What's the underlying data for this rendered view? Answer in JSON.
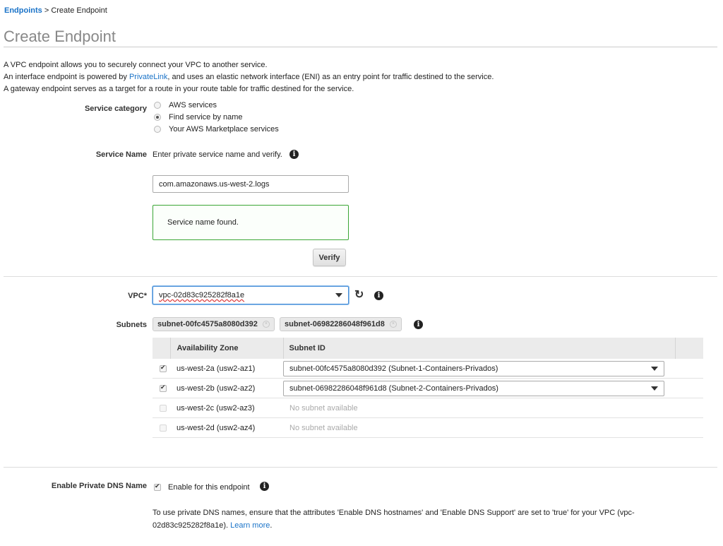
{
  "breadcrumb": {
    "parent": "Endpoints",
    "separator": " > ",
    "current": "Create Endpoint"
  },
  "page_title": "Create Endpoint",
  "intro": {
    "line1": "A VPC endpoint allows you to securely connect your VPC to another service.",
    "line2_before": "An interface endpoint is powered by ",
    "line2_link": "PrivateLink",
    "line2_after": ", and uses an elastic network interface (ENI) as an entry point for traffic destined to the service.",
    "line3": "A gateway endpoint serves as a target for a route in your route table for traffic destined for the service."
  },
  "service_category": {
    "label": "Service category",
    "options": [
      "AWS services",
      "Find service by name",
      "Your AWS Marketplace services"
    ],
    "selected": "Find service by name"
  },
  "service_name": {
    "label": "Service Name",
    "hint": "Enter private service name and verify.",
    "value": "com.amazonaws.us-west-2.logs",
    "status": "Service name found.",
    "verify_label": "Verify"
  },
  "vpc": {
    "label": "VPC*",
    "value": "vpc-02d83c925282f8a1e"
  },
  "subnets": {
    "label": "Subnets",
    "tags": [
      "subnet-00fc4575a8080d392",
      "subnet-06982286048f961d8"
    ],
    "columns": [
      "Availability Zone",
      "Subnet ID"
    ],
    "rows": [
      {
        "checked": true,
        "az": "us-west-2a (usw2-az1)",
        "subnet": "subnet-00fc4575a8080d392 (Subnet-1-Containers-Privados)",
        "available": true
      },
      {
        "checked": true,
        "az": "us-west-2b (usw2-az2)",
        "subnet": "subnet-06982286048f961d8 (Subnet-2-Containers-Privados)",
        "available": true
      },
      {
        "checked": false,
        "az": "us-west-2c (usw2-az3)",
        "subnet": "No subnet available",
        "available": false
      },
      {
        "checked": false,
        "az": "us-west-2d (usw2-az4)",
        "subnet": "No subnet available",
        "available": false
      }
    ]
  },
  "private_dns": {
    "label": "Enable Private DNS Name",
    "checked": true,
    "checkbox_label": "Enable for this endpoint",
    "note_line1": "To use private DNS names, ensure that the attributes 'Enable DNS hostnames' and 'Enable DNS Support' are set to 'true' for your VPC (vpc-",
    "note_line2_before": "02d83c925282f8a1e). ",
    "note_link": "Learn more",
    "note_line2_after": "."
  },
  "colors": {
    "link": "#1a73c8",
    "success_border": "#3aa635",
    "focus_border": "#4a90d9"
  },
  "icons": {
    "info": "info-icon",
    "refresh": "refresh-icon",
    "dropdown": "caret-down-icon",
    "remove_tag": "remove-tag-icon"
  }
}
